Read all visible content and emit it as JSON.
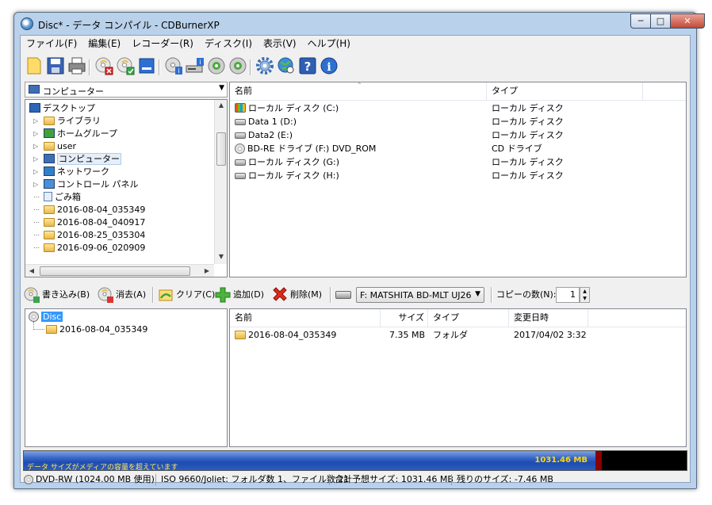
{
  "window": {
    "title": "Disc* - データ コンパイル - CDBurnerXP",
    "controls": {
      "minimize": "─",
      "maximize": "□",
      "close": "✕"
    }
  },
  "menu": [
    "ファイル(F)",
    "編集(E)",
    "レコーダー(R)",
    "ディスク(I)",
    "表示(V)",
    "ヘルプ(H)"
  ],
  "toolbar": {
    "icons": [
      "new-icon",
      "save-icon",
      "print-icon",
      "erase-disc-icon",
      "burn-disc-icon",
      "blue-square-icon",
      "disc-info-icon",
      "drive-info-icon",
      "disc-green-icon",
      "disc-green2-icon",
      "gear-icon",
      "globe-icon",
      "help-icon",
      "info-icon"
    ]
  },
  "location": {
    "label": "コンピューター"
  },
  "tree": [
    {
      "label": "デスクトップ",
      "icon": "desktop-icon",
      "indent": 0
    },
    {
      "label": "ライブラリ",
      "icon": "library-icon",
      "indent": 1,
      "expander": true
    },
    {
      "label": "ホームグループ",
      "icon": "homegroup-icon",
      "indent": 1,
      "expander": true
    },
    {
      "label": "user",
      "icon": "user-folder-icon",
      "indent": 1,
      "expander": true
    },
    {
      "label": "コンピューター",
      "icon": "computer-icon",
      "indent": 1,
      "expander": true,
      "selected": true
    },
    {
      "label": "ネットワーク",
      "icon": "network-icon",
      "indent": 1,
      "expander": true
    },
    {
      "label": "コントロール パネル",
      "icon": "control-panel-icon",
      "indent": 1,
      "expander": true
    },
    {
      "label": "ごみ箱",
      "icon": "recycle-bin-icon",
      "indent": 1
    },
    {
      "label": "2016-08-04_035349",
      "icon": "folder-icon",
      "indent": 1
    },
    {
      "label": "2016-08-04_040917",
      "icon": "folder-icon",
      "indent": 1
    },
    {
      "label": "2016-08-25_035304",
      "icon": "folder-icon",
      "indent": 1
    },
    {
      "label": "2016-09-06_020909",
      "icon": "folder-icon",
      "indent": 1
    }
  ],
  "drives_list": {
    "headers": {
      "name": "名前",
      "type": "タイプ"
    },
    "rows": [
      {
        "name": "ローカル ディスク (C:)",
        "type": "ローカル ディスク",
        "icon": "system-drive-icon"
      },
      {
        "name": "Data 1 (D:)",
        "type": "ローカル ディスク",
        "icon": "drive-icon"
      },
      {
        "name": "Data2 (E:)",
        "type": "ローカル ディスク",
        "icon": "drive-icon"
      },
      {
        "name": "BD-RE ドライブ (F:) DVD_ROM",
        "type": "CD ドライブ",
        "icon": "disc-icon"
      },
      {
        "name": "ローカル ディスク (G:)",
        "type": "ローカル ディスク",
        "icon": "drive-icon"
      },
      {
        "name": "ローカル ディスク (H:)",
        "type": "ローカル ディスク",
        "icon": "drive-icon"
      }
    ]
  },
  "actions": {
    "write": "書き込み(B)",
    "erase": "消去(A)",
    "clear": "クリア(C)",
    "add": "追加(D)",
    "delete": "削除(M)",
    "drive": "F: MATSHITA BD-MLT UJ26",
    "copies_label": "コピーの数(N):",
    "copies_value": "1"
  },
  "compilation_tree": {
    "root": "Disc",
    "children": [
      "2016-08-04_035349"
    ]
  },
  "compilation_list": {
    "headers": {
      "name": "名前",
      "size": "サイズ",
      "type": "タイプ",
      "modified": "変更日時"
    },
    "rows": [
      {
        "name": "2016-08-04_035349",
        "size": "7.35 MB",
        "type": "フォルダ",
        "modified": "2017/04/02 3:32"
      }
    ]
  },
  "capacity": {
    "message": "データ サイズがメディアの容量を超えています",
    "value": "1031.46 MB",
    "used_fraction": 0.862,
    "over_fraction": 0.01,
    "colors": {
      "fill": "#2b5cc0",
      "over": "#8a0000",
      "text": "#ffd500"
    }
  },
  "status": {
    "media": "DVD-RW (1024.00 MB 使用)",
    "fs": "ISO 9660/Joliet: フォルダ数 1、ファイル数 21",
    "total": "合計予想サイズ: 1031.46 MB",
    "remaining": "残りのサイズ: -7.46 MB"
  }
}
